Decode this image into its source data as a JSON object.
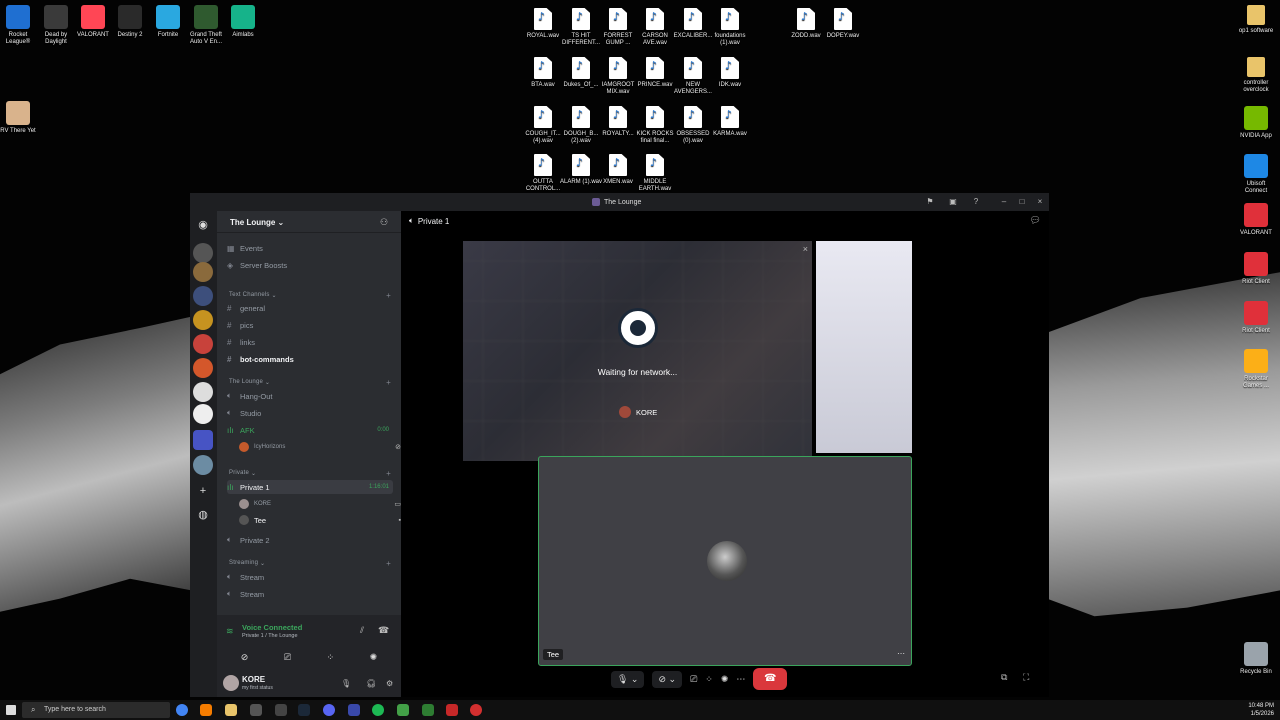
{
  "desktop": {
    "left_icons": [
      {
        "label": "Rocket League®",
        "color": "#1f6fd1"
      },
      {
        "label": "Dead by Daylight",
        "color": "#3a3a3a"
      },
      {
        "label": "VALORANT",
        "color": "#ff4655"
      },
      {
        "label": "Destiny 2",
        "color": "#2a2a2a"
      },
      {
        "label": "Fortnite",
        "color": "#2aa8e0"
      },
      {
        "label": "Grand Theft Auto V En...",
        "color": "#2f5a2f"
      },
      {
        "label": "Aimlabs",
        "color": "#16b38a"
      }
    ],
    "rv_icon": {
      "label": "RV There Yet",
      "color": "#d9b38c"
    },
    "wav_rows": [
      [
        "ROYAL.wav",
        "TS HIT DIFFERENT...",
        "FORREST GUMP ...",
        "CARSON AVE.wav",
        "EXCALIBER...",
        "foundations (1).wav"
      ],
      [
        "BTA.wav",
        "Dukes_Of_...",
        "IAMGROOT MIX.wav",
        "PRINCE.wav",
        "NEW AVENGERS...",
        "IDK.wav"
      ],
      [
        "COUGH_IT... (4).wav",
        "DOUGH_B... (2).wav",
        "ROYALTY...",
        "KICK ROCKS final final...",
        "OBSESSED (0).wav",
        "KARMA.wav"
      ],
      [
        "OUTTA CONTROL...",
        "ALARM (1).wav",
        "XMEN.wav",
        "MIDDLE EARTH.wav"
      ]
    ],
    "wav_extra": [
      "ZODD.wav",
      "DOPEY.wav"
    ],
    "right_icons": [
      {
        "label": "op1 software",
        "kind": "folder",
        "color": "#e9c46a"
      },
      {
        "label": "controller overclock",
        "kind": "folder",
        "color": "#e9c46a"
      },
      {
        "label": "NVIDIA App",
        "kind": "app",
        "color": "#76b900"
      },
      {
        "label": "Ubisoft Connect",
        "kind": "app",
        "color": "#1e88e5"
      },
      {
        "label": "VALORANT",
        "kind": "app",
        "color": "#e0303a"
      },
      {
        "label": "Riot Client",
        "kind": "app",
        "color": "#e0303a"
      },
      {
        "label": "Riot Client",
        "kind": "app",
        "color": "#e0303a"
      },
      {
        "label": "Rockstar Games ...",
        "kind": "app",
        "color": "#fcaf17"
      }
    ],
    "recycle": {
      "label": "Recycle Bin"
    }
  },
  "window": {
    "title": "The Lounge"
  },
  "sidebar": {
    "server_name": "The Lounge",
    "top_items": [
      {
        "label": "Events"
      },
      {
        "label": "Server Boosts"
      }
    ],
    "categories": {
      "text": "Text Channels",
      "lounge": "The Lounge",
      "private": "Private",
      "streaming": "Streaming"
    },
    "text_channels": [
      "general",
      "pics",
      "links",
      "bot-commands"
    ],
    "voice_lounge": [
      "Hang-Out",
      "Studio",
      "AFK"
    ],
    "afk_time": "0:00",
    "afk_member": "IcyHorizons",
    "private_channel": "Private 1",
    "private_time": "1:16:01",
    "private_members": [
      "KORE",
      "Tee"
    ],
    "private2": "Private 2",
    "streaming": [
      "Stream",
      "Stream"
    ]
  },
  "voice": {
    "status": "Voice Connected",
    "location": "Private 1 / The Lounge"
  },
  "user": {
    "name": "KORE",
    "status": "my first status"
  },
  "stage": {
    "channel": "Private 1",
    "stream_status": "Waiting for network...",
    "streamer": "KORE",
    "participant": "Tee"
  },
  "taskbar": {
    "search_placeholder": "Type here to search",
    "time": "10:48 PM",
    "date": "1/5/2026"
  }
}
